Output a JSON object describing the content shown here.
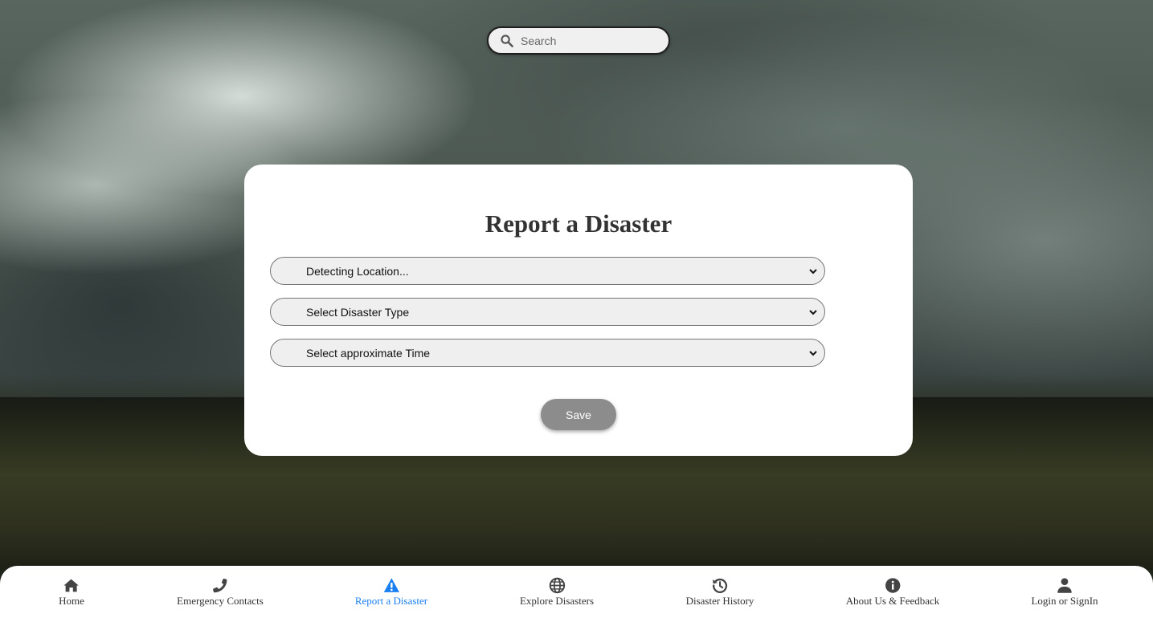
{
  "search": {
    "placeholder": "Search"
  },
  "form": {
    "title": "Report a Disaster",
    "location_select": "Detecting Location...",
    "type_select": "Select Disaster Type",
    "time_select": "Select approximate Time",
    "save_label": "Save"
  },
  "nav": {
    "items": [
      {
        "label": "Home",
        "icon": "home-icon"
      },
      {
        "label": "Emergency Contacts",
        "icon": "phone-icon"
      },
      {
        "label": "Report a Disaster",
        "icon": "warning-icon",
        "active": true
      },
      {
        "label": "Explore Disasters",
        "icon": "globe-icon"
      },
      {
        "label": "Disaster History",
        "icon": "history-icon"
      },
      {
        "label": "About Us & Feedback",
        "icon": "info-icon"
      },
      {
        "label": "Login or SignIn",
        "icon": "user-icon"
      }
    ]
  },
  "colors": {
    "active": "#1a7ff0",
    "icon": "#444444",
    "save_button": "#8c8c8c"
  }
}
